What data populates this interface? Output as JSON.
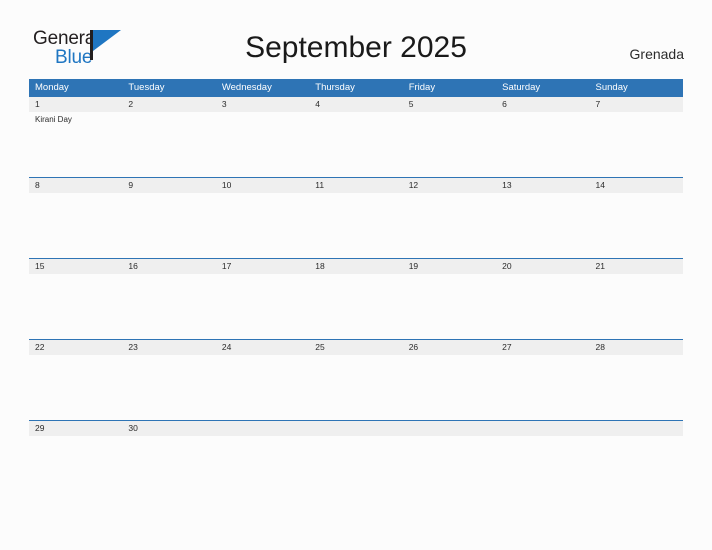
{
  "brand": {
    "name_part1": "General",
    "name_part2": "Blue",
    "flag_icon": "flag-triangle-icon",
    "accent_color": "#1f76c2"
  },
  "header": {
    "title": "September 2025",
    "region": "Grenada"
  },
  "colors": {
    "header_blue": "#2e74b5",
    "date_strip_gray": "#efefef",
    "page_background": "#fcfcfc",
    "text": "#2b2b2b"
  },
  "calendar": {
    "weekdays": [
      "Monday",
      "Tuesday",
      "Wednesday",
      "Thursday",
      "Friday",
      "Saturday",
      "Sunday"
    ],
    "weeks": [
      {
        "days": [
          {
            "date": "1",
            "events": [
              "Kirani Day"
            ]
          },
          {
            "date": "2",
            "events": []
          },
          {
            "date": "3",
            "events": []
          },
          {
            "date": "4",
            "events": []
          },
          {
            "date": "5",
            "events": []
          },
          {
            "date": "6",
            "events": []
          },
          {
            "date": "7",
            "events": []
          }
        ]
      },
      {
        "days": [
          {
            "date": "8",
            "events": []
          },
          {
            "date": "9",
            "events": []
          },
          {
            "date": "10",
            "events": []
          },
          {
            "date": "11",
            "events": []
          },
          {
            "date": "12",
            "events": []
          },
          {
            "date": "13",
            "events": []
          },
          {
            "date": "14",
            "events": []
          }
        ]
      },
      {
        "days": [
          {
            "date": "15",
            "events": []
          },
          {
            "date": "16",
            "events": []
          },
          {
            "date": "17",
            "events": []
          },
          {
            "date": "18",
            "events": []
          },
          {
            "date": "19",
            "events": []
          },
          {
            "date": "20",
            "events": []
          },
          {
            "date": "21",
            "events": []
          }
        ]
      },
      {
        "days": [
          {
            "date": "22",
            "events": []
          },
          {
            "date": "23",
            "events": []
          },
          {
            "date": "24",
            "events": []
          },
          {
            "date": "25",
            "events": []
          },
          {
            "date": "26",
            "events": []
          },
          {
            "date": "27",
            "events": []
          },
          {
            "date": "28",
            "events": []
          }
        ]
      },
      {
        "days": [
          {
            "date": "29",
            "events": []
          },
          {
            "date": "30",
            "events": []
          },
          {
            "date": "",
            "events": []
          },
          {
            "date": "",
            "events": []
          },
          {
            "date": "",
            "events": []
          },
          {
            "date": "",
            "events": []
          },
          {
            "date": "",
            "events": []
          }
        ]
      }
    ]
  }
}
